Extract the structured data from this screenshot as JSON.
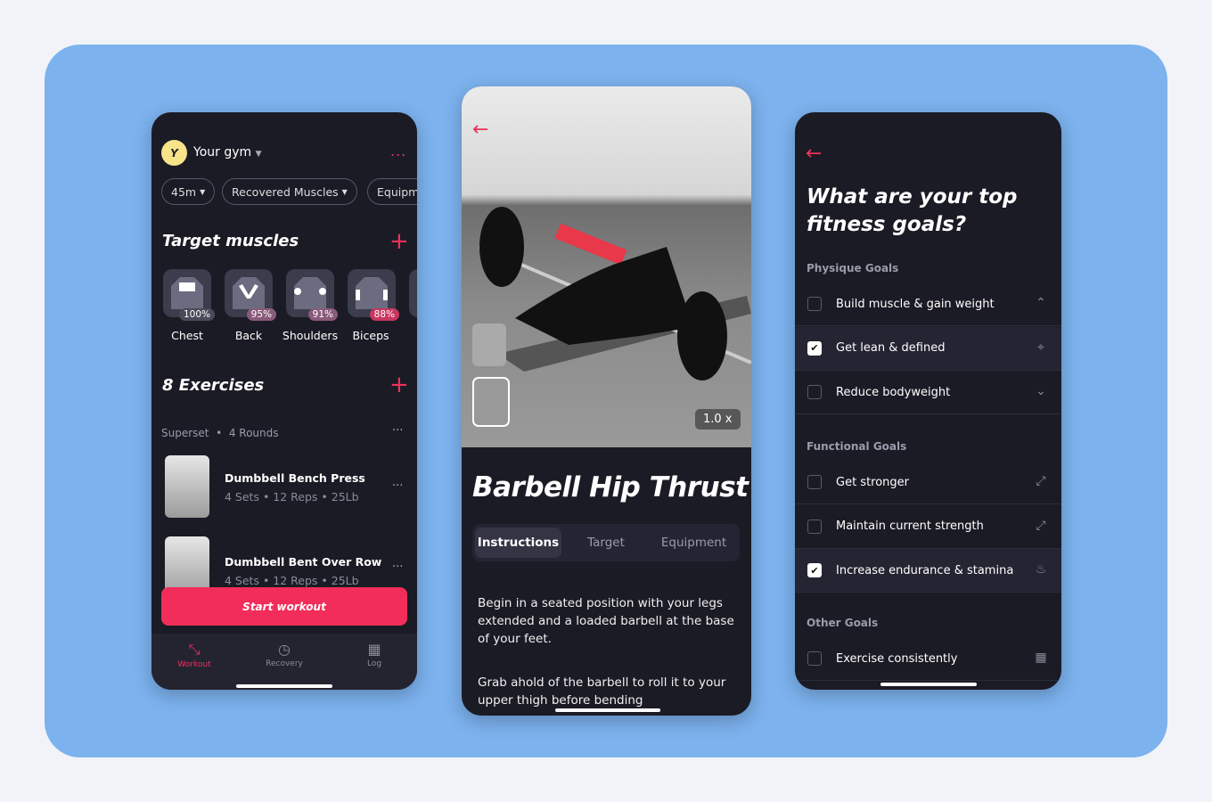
{
  "colors": {
    "accent": "#f22d5a",
    "background": "#7cb2ee",
    "phone": "#1b1b25"
  },
  "screen1": {
    "avatar_letter": "Y",
    "gym": "Your gym",
    "menu": "...",
    "filters": [
      "45m",
      "Recovered Muscles",
      "Equipm"
    ],
    "target_title": "Target muscles",
    "muscles": [
      {
        "label": "Chest",
        "pct": "100%"
      },
      {
        "label": "Back",
        "pct": "95%"
      },
      {
        "label": "Shoulders",
        "pct": "91%"
      },
      {
        "label": "Biceps",
        "pct": "88%"
      }
    ],
    "exercises_title": "8 Exercises",
    "superset": "Superset",
    "rounds": "4 Rounds",
    "exercises": [
      {
        "name": "Dumbbell Bench Press",
        "meta": "4 Sets • 12 Reps  • 25Lb"
      },
      {
        "name": "Dumbbell Bent Over Row",
        "meta": "4 Sets • 12 Reps  • 25Lb"
      }
    ],
    "start": "Start workout",
    "nav": [
      {
        "label": "Workout",
        "icon": "dumbbell-icon"
      },
      {
        "label": "Recovery",
        "icon": "recovery-clock-icon"
      },
      {
        "label": "Log",
        "icon": "calendar-icon"
      }
    ]
  },
  "screen2": {
    "speed": "1.0 x",
    "title": "Barbell Hip Thrust",
    "tabs": [
      "Instructions",
      "Target",
      "Equipment"
    ],
    "para1": "Begin in a seated position with your legs extended and a loaded barbell at the base of your feet.",
    "para2": "Grab ahold of the barbell to roll it to your upper thigh before bending"
  },
  "screen3": {
    "question": "What are your top fitness goals?",
    "sections": [
      {
        "title": "Physique Goals",
        "items": [
          {
            "label": "Build muscle & gain weight",
            "checked": false,
            "icon": "up-circle-icon"
          },
          {
            "label": "Get lean & defined",
            "checked": true,
            "icon": "target-icon"
          },
          {
            "label": "Reduce bodyweight",
            "checked": false,
            "icon": "down-circle-icon"
          }
        ]
      },
      {
        "title": "Functional Goals",
        "items": [
          {
            "label": "Get stronger",
            "checked": false,
            "icon": "expand-arrows-icon"
          },
          {
            "label": "Maintain current strength",
            "checked": false,
            "icon": "expand-arrows-icon"
          },
          {
            "label": "Increase endurance & stamina",
            "checked": true,
            "icon": "flame-icon"
          }
        ]
      },
      {
        "title": "Other Goals",
        "items": [
          {
            "label": "Exercise consistently",
            "checked": false,
            "icon": "calendar-icon"
          }
        ]
      }
    ]
  }
}
